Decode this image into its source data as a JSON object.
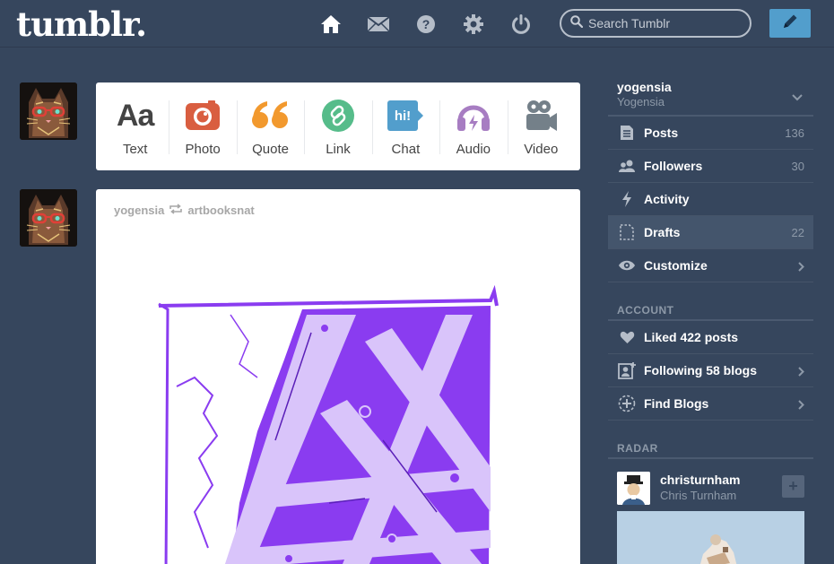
{
  "header": {
    "logo": "tumblr.",
    "nav": [
      "home-icon",
      "mail-icon",
      "help-icon",
      "gear-icon",
      "power-icon"
    ],
    "search_placeholder": "Search Tumblr",
    "compose_icon": "pencil-icon"
  },
  "post_types": [
    {
      "label": "Text",
      "icon": "text-icon",
      "color": "#444444"
    },
    {
      "label": "Photo",
      "icon": "camera-icon",
      "color": "#d95e40"
    },
    {
      "label": "Quote",
      "icon": "quote-icon",
      "color": "#f2992e"
    },
    {
      "label": "Link",
      "icon": "link-icon",
      "color": "#56bc8a"
    },
    {
      "label": "Chat",
      "icon": "chat-icon",
      "color": "#529ecc",
      "badge": "hi!"
    },
    {
      "label": "Audio",
      "icon": "headphones-icon",
      "color": "#a77dc2"
    },
    {
      "label": "Video",
      "icon": "video-camera-icon",
      "color": "#748089"
    }
  ],
  "post": {
    "author": "yogensia",
    "reblogged_from": "artbooksnat"
  },
  "sidebar": {
    "blog_name": "yogensia",
    "blog_title": "Yogensia",
    "items": [
      {
        "label": "Posts",
        "count": "136",
        "icon": "posts-icon"
      },
      {
        "label": "Followers",
        "count": "30",
        "icon": "followers-icon"
      },
      {
        "label": "Activity",
        "count": "",
        "icon": "lightning-icon"
      },
      {
        "label": "Drafts",
        "count": "22",
        "icon": "drafts-icon"
      },
      {
        "label": "Customize",
        "count": "",
        "icon": "eye-icon"
      }
    ],
    "account_title": "ACCOUNT",
    "account_items": [
      {
        "label": "Liked 422 posts",
        "icon": "heart-icon"
      },
      {
        "label": "Following 58 blogs",
        "icon": "following-icon"
      },
      {
        "label": "Find Blogs",
        "icon": "find-blogs-icon"
      }
    ],
    "radar_title": "RADAR",
    "radar": {
      "name": "christurnham",
      "subtitle": "Chris Turnham",
      "follow": "+"
    }
  },
  "colors": {
    "background": "#36465d",
    "accent": "#529ecc",
    "art": "#8a3cf0"
  }
}
